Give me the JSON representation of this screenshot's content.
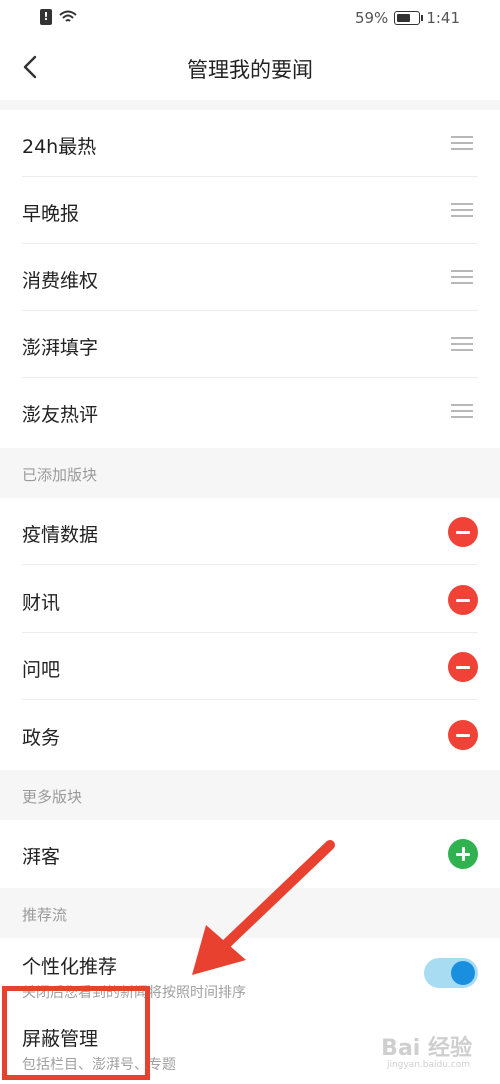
{
  "status": {
    "battery": "59%",
    "time": "1:41",
    "sim": "!"
  },
  "header": {
    "title": "管理我的要闻"
  },
  "pinned": [
    {
      "label": "24h最热"
    },
    {
      "label": "早晚报"
    },
    {
      "label": "消费维权"
    },
    {
      "label": "澎湃填字"
    },
    {
      "label": "澎友热评"
    }
  ],
  "added_section": {
    "title": "已添加版块",
    "items": [
      {
        "label": "疫情数据"
      },
      {
        "label": "财讯"
      },
      {
        "label": "问吧"
      },
      {
        "label": "政务"
      }
    ]
  },
  "more_section": {
    "title": "更多版块",
    "items": [
      {
        "label": "湃客"
      }
    ]
  },
  "recommend_section": {
    "title": "推荐流",
    "personalized": {
      "label": "个性化推荐",
      "desc": "关闭后您看到的新闻将按照时间排序",
      "enabled": true
    },
    "block": {
      "label": "屏蔽管理",
      "desc": "包括栏目、澎湃号、专题"
    }
  },
  "watermark": {
    "main": "Bai 经验",
    "sub": "jingyan.baidu.com"
  },
  "colors": {
    "remove": "#f04236",
    "add": "#2fb24f",
    "toggle": "#1a8fe0",
    "annotation": "#e8412f"
  }
}
